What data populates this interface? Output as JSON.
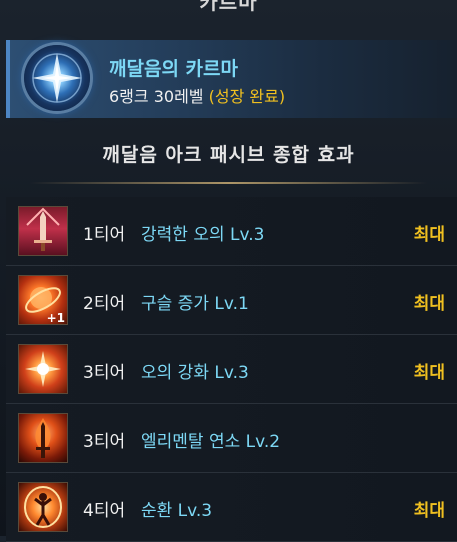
{
  "window": {
    "title": "카르마"
  },
  "karma": {
    "name": "깨달음의 카르마",
    "rank_text": "6랭크 30레벨",
    "growth_text": "(성장 완료)",
    "emblem_icon": "compass-star-icon"
  },
  "section": {
    "header": "깨달음 아크 패시브 종합 효과"
  },
  "passives": [
    {
      "tier": "1티어",
      "skill": "강력한 오의 Lv.3",
      "status": "최대",
      "icon": "sword-icon"
    },
    {
      "tier": "2티어",
      "skill": "구슬 증가 Lv.1",
      "status": "최대",
      "icon": "orb-icon",
      "badge": "+1"
    },
    {
      "tier": "3티어",
      "skill": "오의 강화 Lv.3",
      "status": "최대",
      "icon": "burst-icon"
    },
    {
      "tier": "3티어",
      "skill": "엘리멘탈 연소 Lv.2",
      "status": "",
      "icon": "flame-sword-icon"
    },
    {
      "tier": "4티어",
      "skill": "순환 Lv.3",
      "status": "최대",
      "icon": "figure-aura-icon"
    }
  ],
  "colors": {
    "accent_blue": "#7dd8f5",
    "accent_gold": "#f0c020",
    "card_border": "#4d86c4"
  }
}
